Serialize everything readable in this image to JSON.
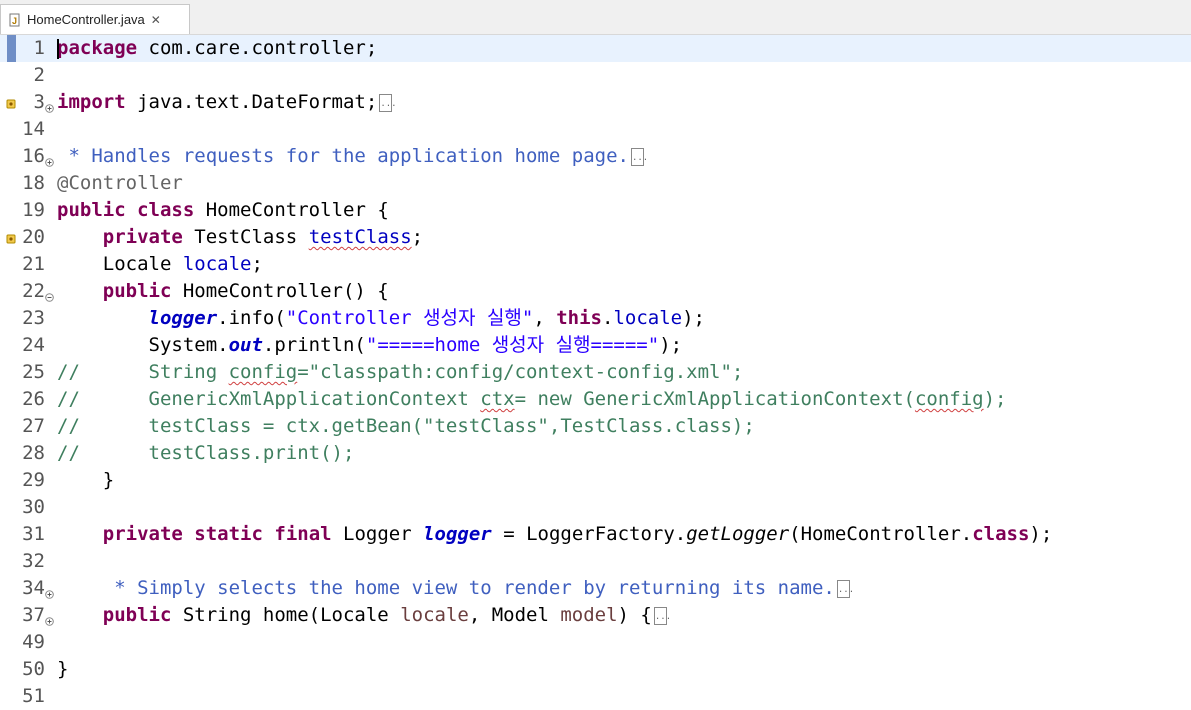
{
  "tab": {
    "title": "HomeController.java",
    "close": "✕"
  },
  "lines": [
    {
      "num": "1"
    },
    {
      "num": "2"
    },
    {
      "num": "3"
    },
    {
      "num": "14"
    },
    {
      "num": "16"
    },
    {
      "num": "18"
    },
    {
      "num": "19"
    },
    {
      "num": "20"
    },
    {
      "num": "21"
    },
    {
      "num": "22"
    },
    {
      "num": "23"
    },
    {
      "num": "24"
    },
    {
      "num": "25"
    },
    {
      "num": "26"
    },
    {
      "num": "27"
    },
    {
      "num": "28"
    },
    {
      "num": "29"
    },
    {
      "num": "30"
    },
    {
      "num": "31"
    },
    {
      "num": "32"
    },
    {
      "num": "34"
    },
    {
      "num": "37"
    },
    {
      "num": "49"
    },
    {
      "num": "50"
    },
    {
      "num": "51"
    }
  ],
  "code": {
    "l1_kw": "package",
    "l1_rest": " com.care.controller;",
    "l3_kw": "import",
    "l3_rest": " java.text.DateFormat;",
    "l16_text": " * Handles requests for the application home page.",
    "l18_text": "@Controller",
    "l19_kw1": "public",
    "l19_kw2": "class",
    "l19_rest": " HomeController {",
    "l20_indent": "    ",
    "l20_kw": "private",
    "l20_type": " TestClass ",
    "l20_field": "testClass",
    "l20_end": ";",
    "l21_type": "    Locale ",
    "l21_field": "locale",
    "l21_end": ";",
    "l22_indent": "    ",
    "l22_kw": "public",
    "l22_rest": " HomeController() {",
    "l23_indent": "        ",
    "l23_logger": "logger",
    "l23_mid": ".info(",
    "l23_str": "\"Controller 생성자 실행\"",
    "l23_comma": ", ",
    "l23_this": "this",
    "l23_dot": ".",
    "l23_field": "locale",
    "l23_end": ");",
    "l24_pre": "        System.",
    "l24_out": "out",
    "l24_mid": ".println(",
    "l24_str": "\"=====home 생성자 실행=====\"",
    "l24_end": ");",
    "l25_a": "//      String ",
    "l25_b": "config",
    "l25_c": "=\"classpath:config/context-config.xml\";",
    "l26_a": "//      GenericXmlApplicationContext ",
    "l26_b": "ctx",
    "l26_c": "= new GenericXmlApplicationContext(",
    "l26_d": "config",
    "l26_e": ");",
    "l27_text": "//      testClass = ctx.getBean(\"testClass\",TestClass.class);",
    "l28_text": "//      testClass.print();",
    "l29_text": "    }",
    "l31_indent": "    ",
    "l31_kw1": "private",
    "l31_kw2": "static",
    "l31_kw3": "final",
    "l31_type": " Logger ",
    "l31_logger": "logger",
    "l31_mid": " = LoggerFactory.",
    "l31_method": "getLogger",
    "l31_arg": "(HomeController.",
    "l31_class": "class",
    "l31_end": ");",
    "l34_text": "     * Simply selects the home view to render by returning its name.",
    "l37_indent": "    ",
    "l37_kw": "public",
    "l37_mid": " String home(Locale ",
    "l37_p1": "locale",
    "l37_mid2": ", Model ",
    "l37_p2": "model",
    "l37_end": ") {",
    "l50_text": "}"
  }
}
